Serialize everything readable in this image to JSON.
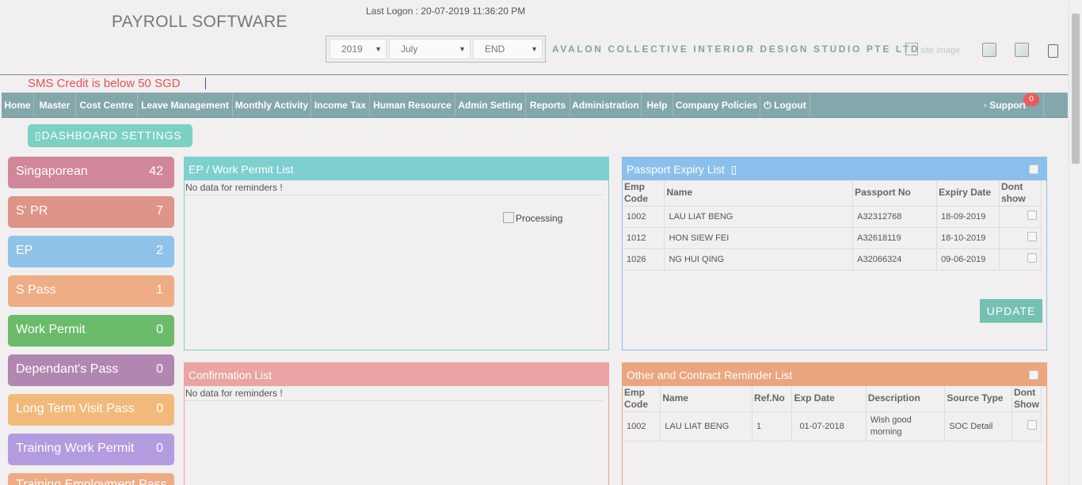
{
  "header": {
    "app_title": "PAYROLL SOFTWARE",
    "last_logon": "Last Logon : 20-07-2019 11:36:20 PM",
    "year": "2019",
    "month": "July",
    "period": "END",
    "company": "AVALON COLLECTIVE INTERIOR DESIGN STUDIO PTE LTD",
    "site_image_alt": "site image",
    "sms_alert": "SMS Credit is below 50 SGD"
  },
  "nav": {
    "items": [
      "Home",
      "Master",
      "Cost Centre",
      "Leave Management",
      "Monthly Activity",
      "Income Tax",
      "Human Resource",
      "Admin Setting",
      "Reports",
      "Administration",
      "Help",
      "Company Policies",
      "Logout"
    ],
    "logout_icon": "power-icon",
    "support_label": "Support",
    "support_badge": "0"
  },
  "dashboard_settings": "DASHBOARD SETTINGS",
  "tiles": [
    {
      "label": "Singaporean",
      "count": "42",
      "color": "#d2869a"
    },
    {
      "label": "S' PR",
      "count": "7",
      "color": "#de9487"
    },
    {
      "label": "EP",
      "count": "2",
      "color": "#8fc3ea"
    },
    {
      "label": "S Pass",
      "count": "1",
      "color": "#eead85"
    },
    {
      "label": "Work Permit",
      "count": "0",
      "color": "#6bbb6b"
    },
    {
      "label": "Dependant's Pass",
      "count": "0",
      "color": "#b187b2"
    },
    {
      "label": "Long Term Visit Pass",
      "count": "0",
      "color": "#f2ba7a"
    },
    {
      "label": "Training Work Permit",
      "count": "0",
      "color": "#b39be0"
    },
    {
      "label": "Training Employment Pass",
      "count": "",
      "color": "#eeab85"
    }
  ],
  "ep_panel": {
    "title": "EP / Work Permit List",
    "no_data": "No data for reminders !",
    "processing_alt": "Processing"
  },
  "confirmation_panel": {
    "title": "Confirmation List",
    "no_data": "No data for reminders !"
  },
  "passport_panel": {
    "title": "Passport Expiry List",
    "columns": [
      "Emp Code",
      "Name",
      "Passport No",
      "Expiry Date",
      "Dont show"
    ],
    "rows": [
      {
        "code": "1002",
        "name": "LAU LIAT BENG",
        "passport": "A32312768",
        "expiry": "18-09-2019"
      },
      {
        "code": "1012",
        "name": "HON SIEW FEI",
        "passport": "A32618119",
        "expiry": "18-10-2019"
      },
      {
        "code": "1026",
        "name": "NG HUI QING",
        "passport": "A32066324",
        "expiry": "09-06-2019"
      }
    ],
    "update_label": "UPDATE"
  },
  "contract_panel": {
    "title": "Other and Contract Reminder List",
    "columns": [
      "Emp Code",
      "Name",
      "Ref.No",
      "Exp Date",
      "Description",
      "Source Type",
      "Dont Show"
    ],
    "rows": [
      {
        "code": "1002",
        "name": "LAU LIAT BENG",
        "ref": "1",
        "exp": "01-07-2018",
        "desc": "Wish good morning",
        "source": "SOC Detail"
      }
    ]
  },
  "colors": {
    "nav_bg": "#84a7ac",
    "ep_head": "#7ecfcf",
    "confirmation_head": "#eba3a3",
    "passport_head": "#8cc0ec",
    "contract_head": "#eba67f",
    "alert": "#e55353"
  }
}
